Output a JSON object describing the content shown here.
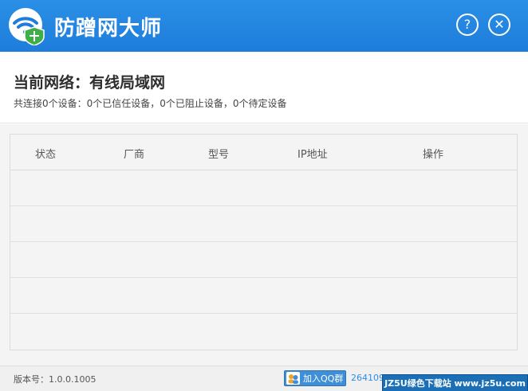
{
  "app": {
    "title": "防蹭网大师",
    "help_label": "?",
    "close_label": "✕"
  },
  "network": {
    "title": "当前网络：有线局域网",
    "summary": "共连接0个设备：0个已信任设备，0个已阻止设备，0个待定设备"
  },
  "table": {
    "columns": [
      "状态",
      "厂商",
      "型号",
      "IP地址",
      "操作"
    ],
    "rows": []
  },
  "footer": {
    "version": "版本号：1.0.0.1005",
    "qq_button": "加入QQ群",
    "qq_number": "264109"
  },
  "watermark": "JZ5U绿色下载站 www.jz5u.com",
  "colors": {
    "titlebar": "#1e7ddb",
    "accent": "#2a8fe6",
    "shield": "#3fae49"
  }
}
